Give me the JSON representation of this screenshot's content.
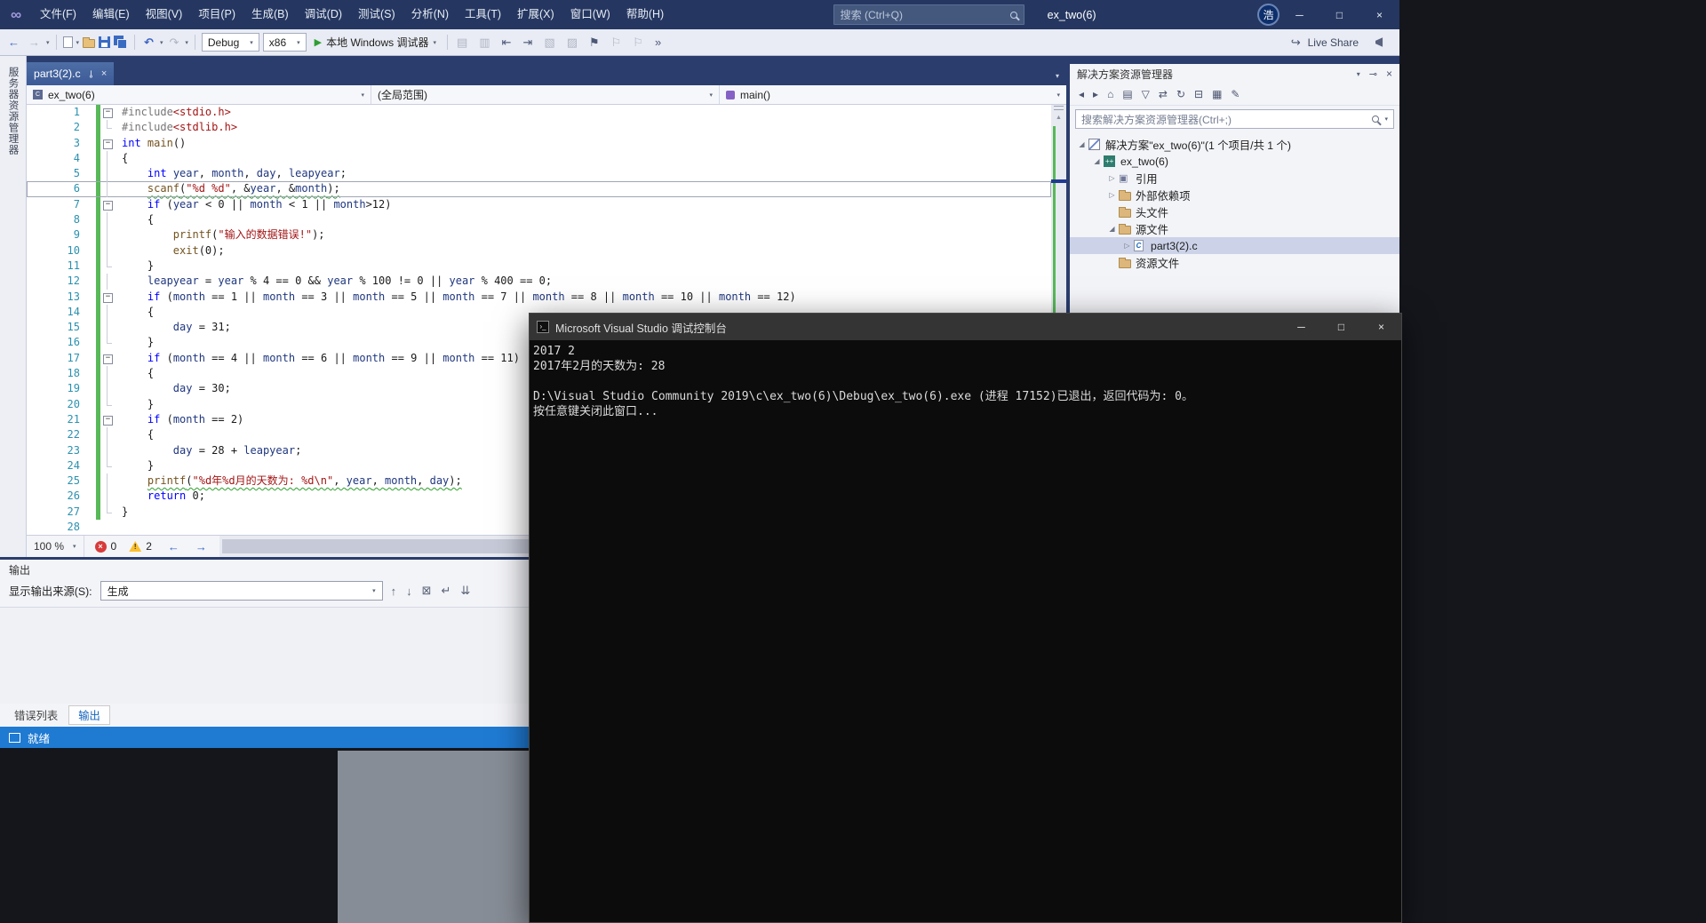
{
  "glyphs": {
    "logo": "∞",
    "minimize": "─",
    "maximize": "□",
    "close": "×",
    "dropdown": "▾",
    "back": "←",
    "forward": "→",
    "undo": "↶",
    "redo": "↷",
    "play": "▶",
    "up": "▲",
    "down": "▼",
    "pin": "⊸",
    "prev": "←",
    "next": "→"
  },
  "window": {
    "title": "ex_two(6)",
    "menus": [
      "文件(F)",
      "编辑(E)",
      "视图(V)",
      "项目(P)",
      "生成(B)",
      "调试(D)",
      "测试(S)",
      "分析(N)",
      "工具(T)",
      "扩展(X)",
      "窗口(W)",
      "帮助(H)"
    ],
    "search_placeholder": "搜索 (Ctrl+Q)",
    "avatar": "浩"
  },
  "toolbar": {
    "config": "Debug",
    "platform": "x86",
    "run_label": "本地 Windows 调试器",
    "live_share_label": "Live Share",
    "extra_icons": [
      {
        "name": "member-list-icon",
        "glyph": "▤",
        "dim": true
      },
      {
        "name": "parameter-info-icon",
        "glyph": "▥",
        "dim": true
      },
      {
        "name": "decrease-indent-icon",
        "glyph": "⇤",
        "dim": false
      },
      {
        "name": "increase-indent-icon",
        "glyph": "⇥",
        "dim": false
      },
      {
        "name": "comment-icon",
        "glyph": "▧",
        "dim": true
      },
      {
        "name": "uncomment-icon",
        "glyph": "▨",
        "dim": true
      },
      {
        "name": "toggle-bookmark-icon",
        "glyph": "⚑",
        "dim": false
      },
      {
        "name": "prev-bookmark-icon",
        "glyph": "⚐",
        "dim": true
      },
      {
        "name": "next-bookmark-icon",
        "glyph": "⚐",
        "dim": true
      },
      {
        "name": "toolbar-overflow-icon",
        "glyph": "»",
        "dim": false
      }
    ]
  },
  "left_rail": {
    "label": "服务器资源管理器"
  },
  "editor": {
    "tab_label": "part3(2).c",
    "navbar": {
      "project": "ex_two(6)",
      "scope": "(全局范围)",
      "member": "main()"
    },
    "zoom": "100 %",
    "error_count": "0",
    "warning_count": "2",
    "code": [
      {
        "n": 1,
        "fold": "box",
        "chg": true,
        "tk": [
          [
            "d",
            "#include"
          ],
          [
            "s",
            "<stdio.h>"
          ]
        ]
      },
      {
        "n": 2,
        "fold": "end",
        "chg": true,
        "tk": [
          [
            "d",
            "#include"
          ],
          [
            "s",
            "<stdlib.h>"
          ]
        ]
      },
      {
        "n": 3,
        "fold": "box",
        "chg": true,
        "tk": [
          [
            "k",
            "int"
          ],
          [
            "p",
            " "
          ],
          [
            "f",
            "main"
          ],
          [
            "p",
            "()"
          ]
        ]
      },
      {
        "n": 4,
        "fold": "bar",
        "chg": true,
        "tk": [
          [
            "p",
            "{"
          ]
        ]
      },
      {
        "n": 5,
        "fold": "bar",
        "chg": true,
        "tk": [
          [
            "p",
            "    "
          ],
          [
            "k",
            "int"
          ],
          [
            "p",
            " "
          ],
          [
            "i",
            "year"
          ],
          [
            "p",
            ", "
          ],
          [
            "i",
            "month"
          ],
          [
            "p",
            ", "
          ],
          [
            "i",
            "day"
          ],
          [
            "p",
            ", "
          ],
          [
            "i",
            "leapyear"
          ],
          [
            "p",
            ";"
          ]
        ]
      },
      {
        "n": 6,
        "fold": "bar",
        "chg": true,
        "cur": true,
        "tk": [
          [
            "p",
            "    "
          ],
          [
            "f",
            "scanf",
            "w"
          ],
          [
            "p",
            "(",
            "w"
          ],
          [
            "s",
            "\"%d %d\"",
            "w"
          ],
          [
            "p",
            ", &",
            "w"
          ],
          [
            "i",
            "year",
            "w"
          ],
          [
            "p",
            ", &",
            "w"
          ],
          [
            "i",
            "month",
            "w"
          ],
          [
            "p",
            ");",
            "w"
          ]
        ]
      },
      {
        "n": 7,
        "fold": "box",
        "chg": true,
        "tk": [
          [
            "p",
            "    "
          ],
          [
            "k",
            "if"
          ],
          [
            "p",
            " ("
          ],
          [
            "i",
            "year"
          ],
          [
            "p",
            " < 0 || "
          ],
          [
            "i",
            "month"
          ],
          [
            "p",
            " < 1 || "
          ],
          [
            "i",
            "month"
          ],
          [
            "p",
            ">12)"
          ]
        ]
      },
      {
        "n": 8,
        "fold": "bar",
        "chg": true,
        "tk": [
          [
            "p",
            "    {"
          ]
        ]
      },
      {
        "n": 9,
        "fold": "bar",
        "chg": true,
        "tk": [
          [
            "p",
            "        "
          ],
          [
            "f",
            "printf"
          ],
          [
            "p",
            "("
          ],
          [
            "s",
            "\"输入的数据错误!\""
          ],
          [
            "p",
            ");"
          ]
        ]
      },
      {
        "n": 10,
        "fold": "bar",
        "chg": true,
        "tk": [
          [
            "p",
            "        "
          ],
          [
            "f",
            "exit"
          ],
          [
            "p",
            "(0);"
          ]
        ]
      },
      {
        "n": 11,
        "fold": "end",
        "chg": true,
        "tk": [
          [
            "p",
            "    }"
          ]
        ]
      },
      {
        "n": 12,
        "fold": "bar",
        "chg": true,
        "tk": [
          [
            "p",
            "    "
          ],
          [
            "i",
            "leapyear"
          ],
          [
            "p",
            " = "
          ],
          [
            "i",
            "year"
          ],
          [
            "p",
            " % 4 == 0 && "
          ],
          [
            "i",
            "year"
          ],
          [
            "p",
            " % 100 != 0 || "
          ],
          [
            "i",
            "year"
          ],
          [
            "p",
            " % 400 == 0;"
          ]
        ]
      },
      {
        "n": 13,
        "fold": "box",
        "chg": true,
        "tk": [
          [
            "p",
            "    "
          ],
          [
            "k",
            "if"
          ],
          [
            "p",
            " ("
          ],
          [
            "i",
            "month"
          ],
          [
            "p",
            " == 1 || "
          ],
          [
            "i",
            "month"
          ],
          [
            "p",
            " == 3 || "
          ],
          [
            "i",
            "month"
          ],
          [
            "p",
            " == 5 || "
          ],
          [
            "i",
            "month"
          ],
          [
            "p",
            " == 7 || "
          ],
          [
            "i",
            "month"
          ],
          [
            "p",
            " == 8 || "
          ],
          [
            "i",
            "month"
          ],
          [
            "p",
            " == 10 || "
          ],
          [
            "i",
            "month"
          ],
          [
            "p",
            " == 12)"
          ]
        ]
      },
      {
        "n": 14,
        "fold": "bar",
        "chg": true,
        "tk": [
          [
            "p",
            "    {"
          ]
        ]
      },
      {
        "n": 15,
        "fold": "bar",
        "chg": true,
        "tk": [
          [
            "p",
            "        "
          ],
          [
            "i",
            "day"
          ],
          [
            "p",
            " = 31;"
          ]
        ]
      },
      {
        "n": 16,
        "fold": "end",
        "chg": true,
        "tk": [
          [
            "p",
            "    }"
          ]
        ]
      },
      {
        "n": 17,
        "fold": "box",
        "chg": true,
        "tk": [
          [
            "p",
            "    "
          ],
          [
            "k",
            "if"
          ],
          [
            "p",
            " ("
          ],
          [
            "i",
            "month"
          ],
          [
            "p",
            " == 4 || "
          ],
          [
            "i",
            "month"
          ],
          [
            "p",
            " == 6 || "
          ],
          [
            "i",
            "month"
          ],
          [
            "p",
            " == 9 || "
          ],
          [
            "i",
            "month"
          ],
          [
            "p",
            " == 11)"
          ]
        ]
      },
      {
        "n": 18,
        "fold": "bar",
        "chg": true,
        "tk": [
          [
            "p",
            "    {"
          ]
        ]
      },
      {
        "n": 19,
        "fold": "bar",
        "chg": true,
        "tk": [
          [
            "p",
            "        "
          ],
          [
            "i",
            "day"
          ],
          [
            "p",
            " = 30;"
          ]
        ]
      },
      {
        "n": 20,
        "fold": "end",
        "chg": true,
        "tk": [
          [
            "p",
            "    }"
          ]
        ]
      },
      {
        "n": 21,
        "fold": "box",
        "chg": true,
        "tk": [
          [
            "p",
            "    "
          ],
          [
            "k",
            "if"
          ],
          [
            "p",
            " ("
          ],
          [
            "i",
            "month"
          ],
          [
            "p",
            " == 2)"
          ]
        ]
      },
      {
        "n": 22,
        "fold": "bar",
        "chg": true,
        "tk": [
          [
            "p",
            "    {"
          ]
        ]
      },
      {
        "n": 23,
        "fold": "bar",
        "chg": true,
        "tk": [
          [
            "p",
            "        "
          ],
          [
            "i",
            "day"
          ],
          [
            "p",
            " = 28 + "
          ],
          [
            "i",
            "leapyear"
          ],
          [
            "p",
            ";"
          ]
        ]
      },
      {
        "n": 24,
        "fold": "end",
        "chg": true,
        "tk": [
          [
            "p",
            "    }"
          ]
        ]
      },
      {
        "n": 25,
        "fold": "bar",
        "chg": true,
        "tk": [
          [
            "p",
            "    "
          ],
          [
            "f",
            "printf",
            "w"
          ],
          [
            "p",
            "(",
            "w"
          ],
          [
            "s",
            "\"%d年%d月的天数为: %d\\n\"",
            "w"
          ],
          [
            "p",
            ", ",
            "w"
          ],
          [
            "i",
            "year",
            "w"
          ],
          [
            "p",
            ", ",
            "w"
          ],
          [
            "i",
            "month",
            "w"
          ],
          [
            "p",
            ", ",
            "w"
          ],
          [
            "i",
            "day",
            "w"
          ],
          [
            "p",
            ");",
            "w"
          ]
        ]
      },
      {
        "n": 26,
        "fold": "bar",
        "chg": true,
        "tk": [
          [
            "p",
            "    "
          ],
          [
            "k",
            "return"
          ],
          [
            "p",
            " 0;"
          ]
        ]
      },
      {
        "n": 27,
        "fold": "end",
        "chg": true,
        "tk": [
          [
            "p",
            "}"
          ]
        ]
      },
      {
        "n": 28,
        "fold": "",
        "chg": false,
        "tk": []
      }
    ]
  },
  "console": {
    "title": "Microsoft Visual Studio 调试控制台",
    "lines": [
      "2017 2",
      "2017年2月的天数为: 28",
      "",
      "D:\\Visual Studio Community 2019\\c\\ex_two(6)\\Debug\\ex_two(6).exe (进程 17152)已退出，返回代码为: 0。",
      "按任意键关闭此窗口..."
    ]
  },
  "solution_explorer": {
    "title": "解决方案资源管理器",
    "search_placeholder": "搜索解决方案资源管理器(Ctrl+;)",
    "toolbar_icons": [
      {
        "name": "back-icon",
        "glyph": "◂"
      },
      {
        "name": "forward-icon",
        "glyph": "▸"
      },
      {
        "name": "home-icon",
        "glyph": "⌂"
      },
      {
        "name": "switch-views-icon",
        "glyph": "▤"
      },
      {
        "name": "filter-icon",
        "glyph": "▽"
      },
      {
        "name": "sync-with-active-document-icon",
        "glyph": "⇄"
      },
      {
        "name": "refresh-icon",
        "glyph": "↻"
      },
      {
        "name": "collapse-all-icon",
        "glyph": "⊟"
      },
      {
        "name": "show-all-files-icon",
        "glyph": "▦"
      },
      {
        "name": "properties-icon",
        "glyph": "✎"
      }
    ],
    "tree": [
      {
        "label": "解决方案\"ex_two(6)\"(1 个项目/共 1 个)",
        "indent": 0,
        "arrow": "expanded",
        "icon": "solution",
        "selected": false
      },
      {
        "label": "ex_two(6)",
        "indent": 1,
        "arrow": "expanded",
        "icon": "project",
        "selected": false
      },
      {
        "label": "引用",
        "indent": 2,
        "arrow": "collapsed",
        "icon": "references",
        "selected": false
      },
      {
        "label": "外部依赖项",
        "indent": 2,
        "arrow": "collapsed",
        "icon": "folder",
        "selected": false
      },
      {
        "label": "头文件",
        "indent": 2,
        "arrow": "none",
        "icon": "folder",
        "selected": false
      },
      {
        "label": "源文件",
        "indent": 2,
        "arrow": "expanded",
        "icon": "folder",
        "selected": false
      },
      {
        "label": "part3(2).c",
        "indent": 3,
        "arrow": "collapsed",
        "icon": "cfile",
        "selected": true
      },
      {
        "label": "资源文件",
        "indent": 2,
        "arrow": "none",
        "icon": "folder",
        "selected": false
      }
    ]
  },
  "output": {
    "title": "输出",
    "source_label": "显示输出来源(S):",
    "source_value": "生成",
    "icons": [
      {
        "name": "prev-message-icon",
        "glyph": "↑"
      },
      {
        "name": "next-message-icon",
        "glyph": "↓"
      },
      {
        "name": "clear-all-icon",
        "glyph": "⊠"
      },
      {
        "name": "word-wrap-icon",
        "glyph": "↵"
      },
      {
        "name": "autoscroll-icon",
        "glyph": "⇊"
      }
    ],
    "tabs": [
      {
        "label": "错误列表",
        "active": false
      },
      {
        "label": "输出",
        "active": true
      }
    ]
  },
  "status_bar": {
    "ready": "就绪"
  }
}
